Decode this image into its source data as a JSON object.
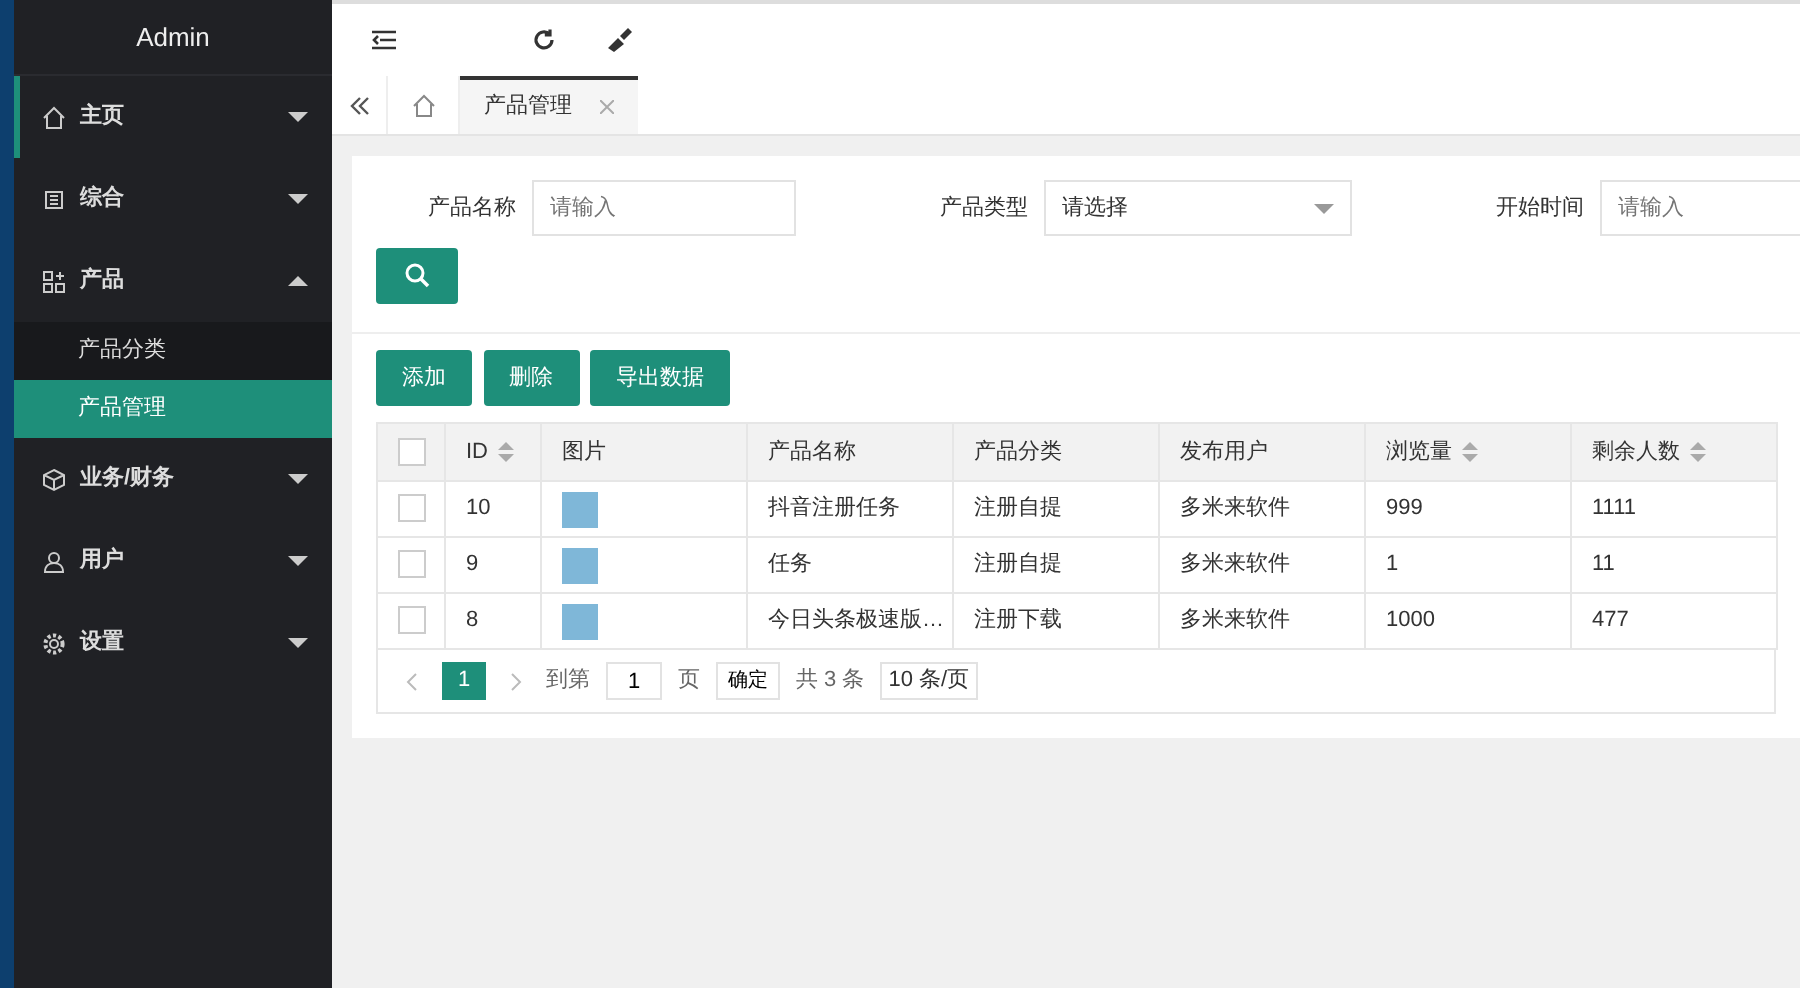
{
  "sidebar": {
    "title": "Admin",
    "items": [
      {
        "label": "主页",
        "expanded": false,
        "hovered": true
      },
      {
        "label": "综合",
        "expanded": false,
        "hovered": false
      },
      {
        "label": "产品",
        "expanded": true,
        "hovered": false,
        "children": [
          {
            "label": "产品分类",
            "selected": false
          },
          {
            "label": "产品管理",
            "selected": true
          }
        ]
      },
      {
        "label": "业务/财务",
        "expanded": false,
        "hovered": false
      },
      {
        "label": "用户",
        "expanded": false,
        "hovered": false
      },
      {
        "label": "设置",
        "expanded": false,
        "hovered": false
      }
    ]
  },
  "tabs": [
    {
      "label": "产品管理",
      "selected": true
    }
  ],
  "filters": [
    {
      "label": "产品名称",
      "kind": "input",
      "placeholder": "请输入"
    },
    {
      "label": "产品类型",
      "kind": "select",
      "value": "请选择"
    },
    {
      "label": "开始时间",
      "kind": "input",
      "placeholder": "请输入"
    }
  ],
  "actions": [
    "添加",
    "删除",
    "导出数据"
  ],
  "table": {
    "all_checked": false,
    "columns": [
      {
        "label": "ID",
        "sortable": true
      },
      {
        "label": "图片",
        "sortable": false
      },
      {
        "label": "产品名称",
        "sortable": false
      },
      {
        "label": "产品分类",
        "sortable": false
      },
      {
        "label": "发布用户",
        "sortable": false
      },
      {
        "label": "浏览量",
        "sortable": true
      },
      {
        "label": "剩余人数",
        "sortable": true
      }
    ],
    "rows": [
      {
        "checked": false,
        "id": "10",
        "name": "抖音注册任务",
        "category": "注册自提",
        "user": "多米来软件",
        "views": "999",
        "remaining": "1111"
      },
      {
        "checked": false,
        "id": "9",
        "name": "任务",
        "category": "注册自提",
        "user": "多米来软件",
        "views": "1",
        "remaining": "11"
      },
      {
        "checked": false,
        "id": "8",
        "name": "今日头条极速版…",
        "category": "注册下载",
        "user": "多米来软件",
        "views": "1000",
        "remaining": "477"
      }
    ]
  },
  "pagination": {
    "pages": [
      {
        "label": "1",
        "selected": true
      }
    ],
    "goto_label": "到第",
    "goto_value": "1",
    "page_label": "页",
    "confirm": "确定",
    "total": "共 3 条",
    "page_size": "10 条/页"
  }
}
